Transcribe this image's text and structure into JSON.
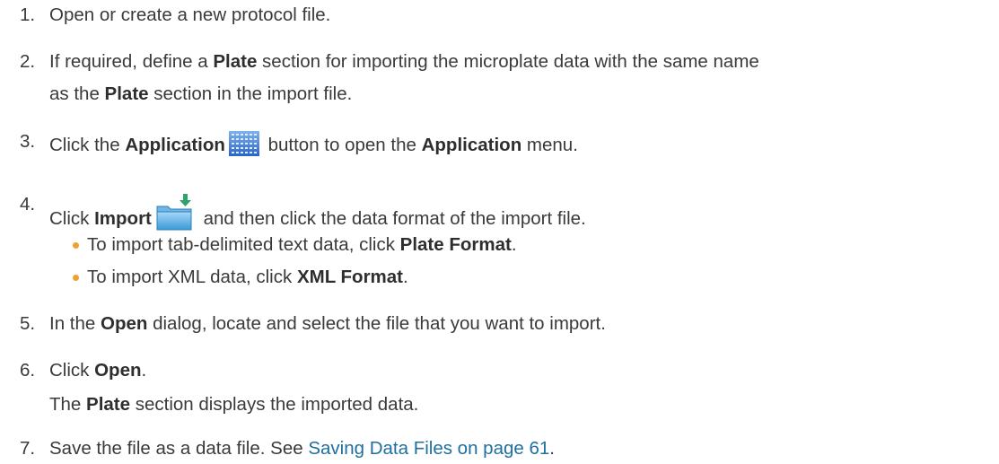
{
  "steps": [
    {
      "num": "1.",
      "text": "Open or create a new protocol file."
    },
    {
      "num": "2.",
      "pre": "If required, define a ",
      "b1": "Plate",
      "mid": " section for importing the microplate data with the same name",
      "cont_pre": "as the ",
      "cont_b": "Plate",
      "cont_post": " section in the import file."
    },
    {
      "num": "3.",
      "pre": "Click the ",
      "b1": "Application",
      "mid": " button to open the ",
      "b2": "Application",
      "post": " menu."
    },
    {
      "num": "4.",
      "pre": "Click ",
      "b1": "Import",
      "post": " and then click the data format of the import file."
    },
    {
      "num": "5.",
      "pre": "In the ",
      "b1": "Open",
      "post": " dialog, locate and select the file that you want to import."
    },
    {
      "num": "6.",
      "pre": "Click ",
      "b1": "Open",
      "post": ".",
      "cont_b": "Plate",
      "cont_post": " section displays the imported data.",
      "cont_pre": "The "
    },
    {
      "num": "7.",
      "pre": "Save the file as a data file. See ",
      "link": "Saving Data Files on page 61",
      "post": "."
    }
  ],
  "bullets": [
    {
      "pre": "To import tab-delimited text data, click ",
      "b": "Plate Format",
      "post": "."
    },
    {
      "pre": "To import XML data, click ",
      "b": "XML Format",
      "post": "."
    }
  ],
  "icons": {
    "application": "application-grid-icon",
    "import": "import-folder-icon"
  },
  "colors": {
    "text": "#3a3a3a",
    "link": "#1f6f9f",
    "bullet": "#f0a030"
  }
}
